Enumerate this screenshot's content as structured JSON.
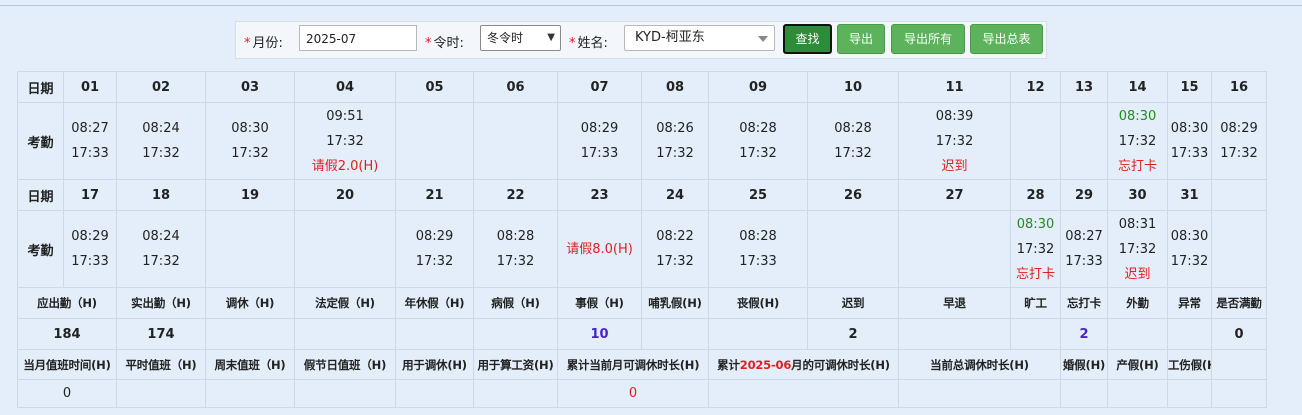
{
  "toolbar": {
    "month_label": "月份:",
    "month_value": "2025-07",
    "shift_label": "令时:",
    "shift_value": "冬令时",
    "name_label": "姓名:",
    "name_value": "KYD-柯亚东",
    "find_label": "查找",
    "export_label": "导出",
    "export_all_label": "导出所有",
    "export_summary_label": "导出总表",
    "required_mark": "*"
  },
  "row_labels": {
    "date": "日期",
    "attendance": "考勤"
  },
  "week1_days": [
    "01",
    "02",
    "03",
    "04",
    "05",
    "06",
    "07",
    "08",
    "09",
    "10",
    "11",
    "12",
    "13",
    "14",
    "15",
    "16"
  ],
  "week2_days": [
    "17",
    "18",
    "19",
    "20",
    "21",
    "22",
    "23",
    "24",
    "25",
    "26",
    "27",
    "28",
    "29",
    "30",
    "31",
    ""
  ],
  "week1_att": [
    {
      "in": "08:27",
      "out": "17:33",
      "note": ""
    },
    {
      "in": "08:24",
      "out": "17:32",
      "note": ""
    },
    {
      "in": "08:30",
      "out": "17:32",
      "note": ""
    },
    {
      "in": "09:51",
      "out": "17:32",
      "note": "请假2.0(H)"
    },
    {
      "in": "",
      "out": "",
      "note": ""
    },
    {
      "in": "",
      "out": "",
      "note": ""
    },
    {
      "in": "08:29",
      "out": "17:33",
      "note": ""
    },
    {
      "in": "08:26",
      "out": "17:32",
      "note": ""
    },
    {
      "in": "08:28",
      "out": "17:32",
      "note": ""
    },
    {
      "in": "08:28",
      "out": "17:32",
      "note": ""
    },
    {
      "in": "08:39",
      "out": "17:32",
      "note": "迟到"
    },
    {
      "in": "",
      "out": "",
      "note": ""
    },
    {
      "in": "",
      "out": "",
      "note": ""
    },
    {
      "in": "08:30",
      "out": "17:32",
      "note": "忘打卡"
    },
    {
      "in": "08:30",
      "out": "17:33",
      "note": ""
    },
    {
      "in": "08:29",
      "out": "17:32",
      "note": ""
    }
  ],
  "week2_att": [
    {
      "in": "08:29",
      "out": "17:33",
      "note": ""
    },
    {
      "in": "08:24",
      "out": "17:32",
      "note": ""
    },
    {
      "in": "",
      "out": "",
      "note": ""
    },
    {
      "in": "",
      "out": "",
      "note": ""
    },
    {
      "in": "08:29",
      "out": "17:32",
      "note": ""
    },
    {
      "in": "08:28",
      "out": "17:32",
      "note": ""
    },
    {
      "in": "",
      "out": "",
      "note": "请假8.0(H)"
    },
    {
      "in": "08:22",
      "out": "17:32",
      "note": ""
    },
    {
      "in": "08:28",
      "out": "17:33",
      "note": ""
    },
    {
      "in": "",
      "out": "",
      "note": ""
    },
    {
      "in": "",
      "out": "",
      "note": ""
    },
    {
      "in": "08:30",
      "out": "17:32",
      "note": "忘打卡"
    },
    {
      "in": "08:27",
      "out": "17:33",
      "note": ""
    },
    {
      "in": "08:31",
      "out": "17:32",
      "note": "迟到"
    },
    {
      "in": "08:30",
      "out": "17:32",
      "note": ""
    },
    {
      "in": "",
      "out": "",
      "note": ""
    }
  ],
  "summary_headers": [
    "应出勤（H)",
    "实出勤（H)",
    "调休（H)",
    "法定假（H)",
    "年休假（H)",
    "病假（H)",
    "事假（H)",
    "哺乳假(H)",
    "丧假(H)",
    "迟到",
    "早退",
    "旷工",
    "忘打卡",
    "外勤",
    "异常",
    "是否满勤"
  ],
  "summary_values": [
    "184",
    "174",
    "",
    "",
    "",
    "",
    "10",
    "",
    "",
    "2",
    "",
    "",
    "2",
    "",
    "",
    "0"
  ],
  "overtime_headers": {
    "h0": "当月值班时间(H)",
    "h1": "平时值班（H)",
    "h2": "周末值班（H)",
    "h3": "假节日值班（H)",
    "h4": "用于调休(H)",
    "h5": "用于算工资(H)",
    "h6": "累计当前月可调休时长(H)",
    "h7_pre": "累计",
    "h7_month": "2025-06",
    "h7_post": "月的可调休时长(H)",
    "h8": "当前总调休时长(H)",
    "h9": "婚假(H)",
    "h10": "产假(H)",
    "h11": "工伤假(H)"
  },
  "overtime_values": {
    "v0": "0",
    "v6": "0"
  },
  "colors": {
    "red": "#e02020",
    "green": "#228b22",
    "purple": "#4a1fd0",
    "button": "#5cb35c",
    "background": "#e3eefa"
  }
}
